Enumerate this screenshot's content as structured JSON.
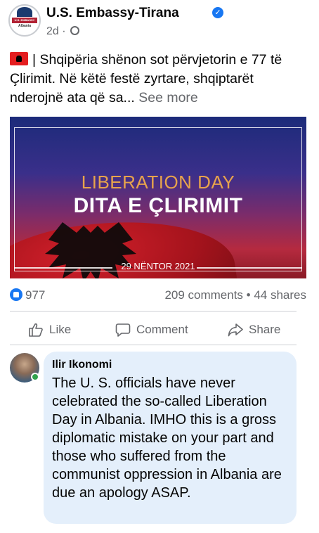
{
  "post": {
    "page_name": "U.S. Embassy-Tirana",
    "avatar": {
      "band_text": "U.S. EMBASSY",
      "sub_text": "Albania"
    },
    "time": "2d",
    "meta_separator": "·",
    "text": "| Shqipëria shënon sot përvjetorin e 77 të Çlirimit. Në këtë festë zyrtare, shqiptarët nderojnë ata që sa...",
    "see_more": "See more",
    "image": {
      "title_en": "LIBERATION DAY",
      "title_sq": "DITA E ÇLIRIMIT",
      "date": "29 NËNTOR 2021"
    },
    "reactions_count": "977",
    "engagement": "209 comments • 44 shares"
  },
  "actions": {
    "like": "Like",
    "comment": "Comment",
    "share": "Share"
  },
  "comment": {
    "author": "Ilir Ikonomi",
    "text": "The U. S. officials have never celebrated the so-called Liberation Day in Albania. IMHO this is a gross diplomatic mistake on your part and   those who suffered from the communist oppression in Albania are due an apology ASAP."
  },
  "colors": {
    "accent": "#1877f2",
    "secondary_text": "#65676b",
    "comment_bubble": "#e4effb",
    "online": "#31a24c"
  },
  "icons": [
    "verified-icon",
    "globe-icon",
    "albania-flag-icon",
    "like-badge-icon",
    "thumbs-up-icon",
    "comment-icon",
    "share-icon"
  ]
}
